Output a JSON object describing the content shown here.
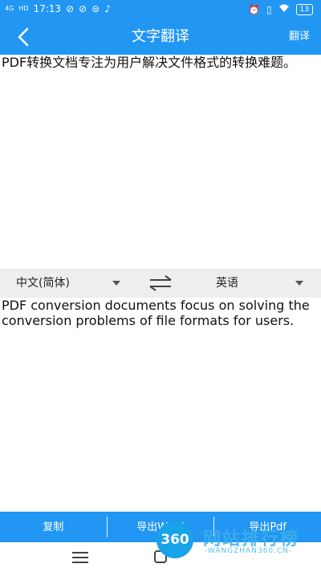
{
  "status_bar": {
    "signal": "4G",
    "signal2": "HD",
    "time": "17:13",
    "battery": "13",
    "icons_left": [
      "signal-icon",
      "hd-icon",
      "notification-icon",
      "notification-icon",
      "tiktok-icon"
    ],
    "icons_right": [
      "alarm-icon",
      "vibrate-icon",
      "wifi-icon",
      "battery-icon"
    ]
  },
  "app_bar": {
    "title": "文字翻译",
    "action_label": "翻译",
    "back_icon": "chevron-left-icon",
    "color": "#2196f3"
  },
  "source_text": "PDF转换文档专注为用户解决文件格式的转换难题。",
  "language_bar": {
    "source_lang": "中文(简体)",
    "target_lang": "英语",
    "swap_icon": "swap-arrows-icon"
  },
  "result_text": "PDF conversion documents focus on solving the conversion problems of file formats for users.",
  "bottom_bar": {
    "copy_label": "复制",
    "export_word_label": "导出Word",
    "export_pdf_label": "导出Pdf"
  },
  "watermark": {
    "logo_number": "360",
    "name": "网站排行榜",
    "url": "-WANGZHAN360.CN-"
  }
}
